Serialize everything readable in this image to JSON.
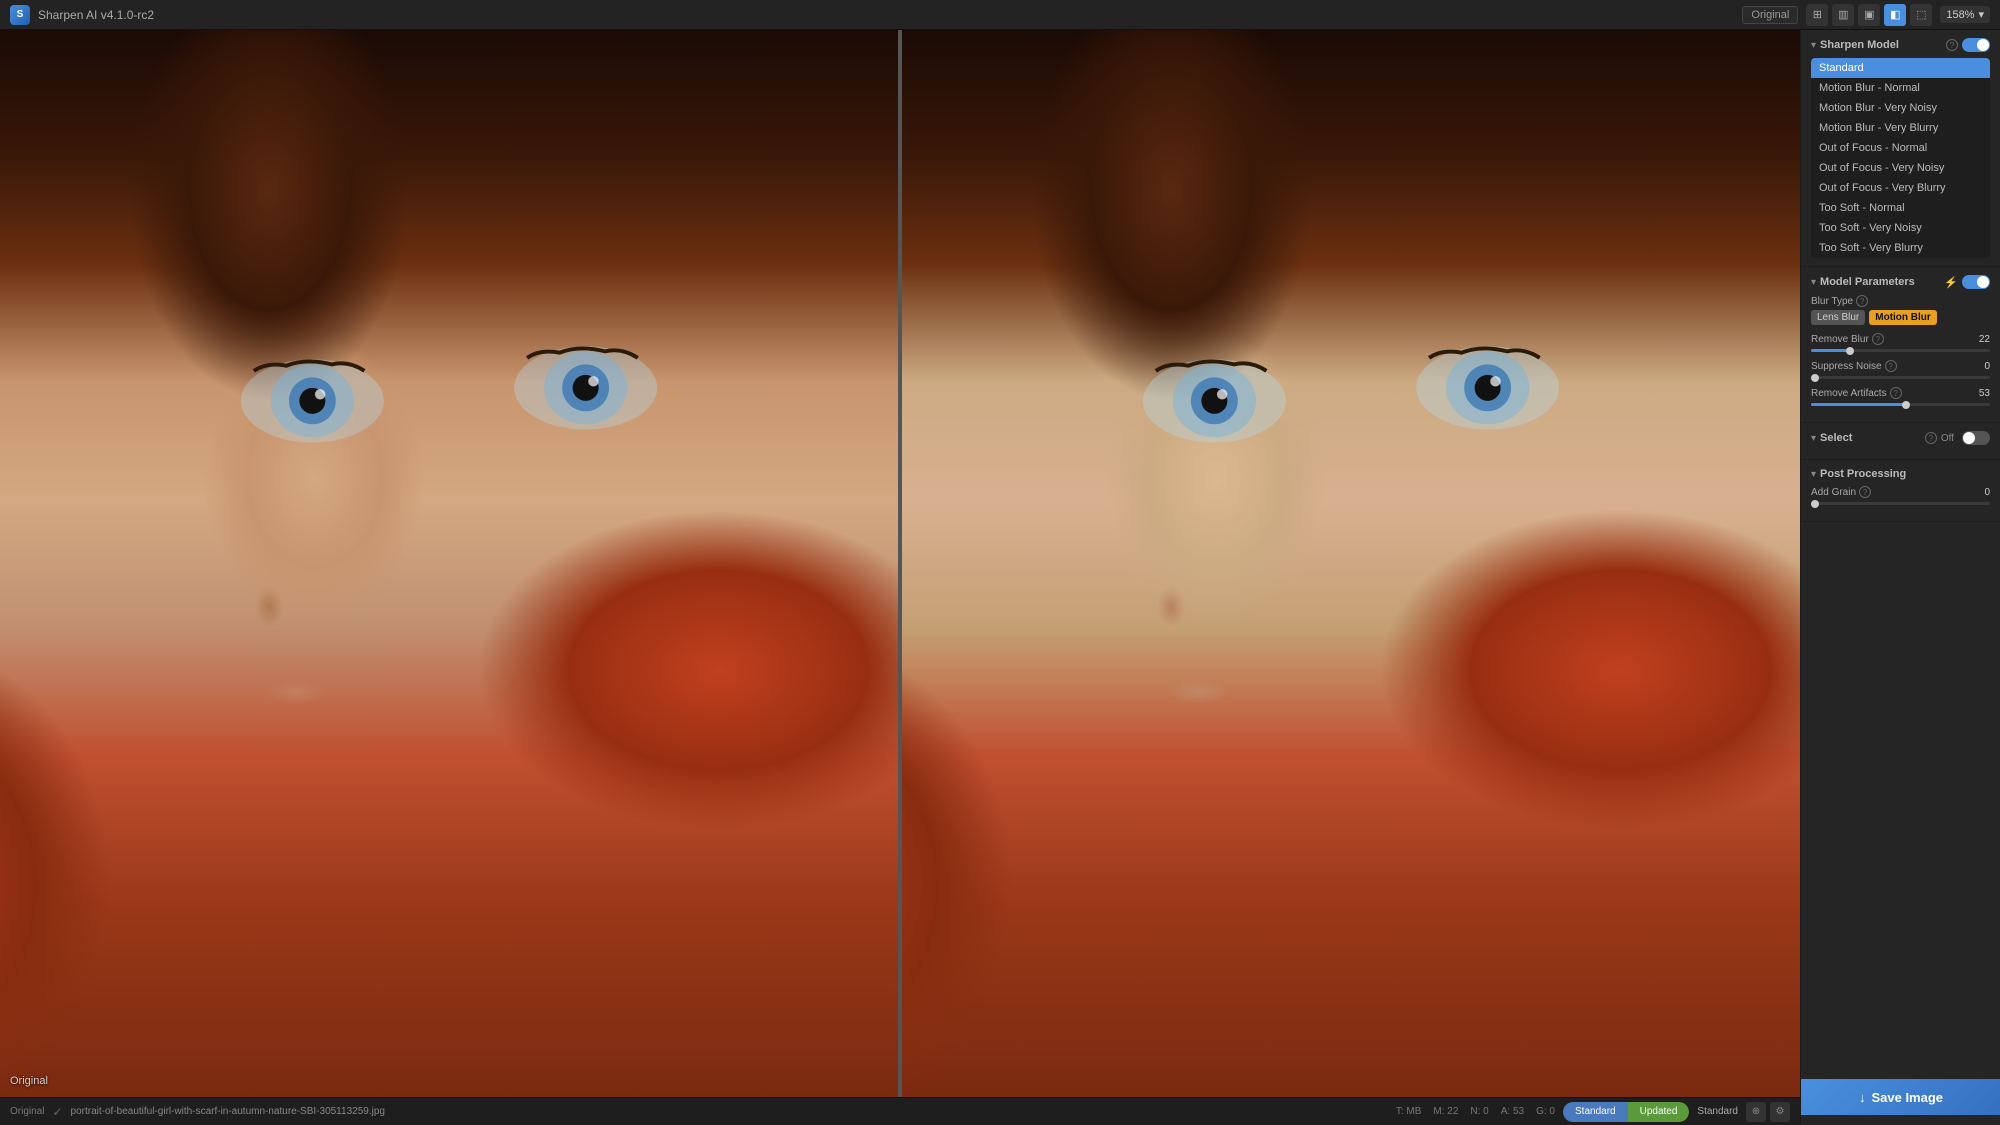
{
  "app": {
    "title": "Sharpen AI",
    "version": "v4.1.0-rc2",
    "logo": "S"
  },
  "topbar": {
    "original_btn": "Original",
    "zoom_level": "158%",
    "view_icons": [
      "grid-2x2",
      "grid-split",
      "side-by-side",
      "single-view",
      "compare"
    ]
  },
  "panels": {
    "sharpen_model": {
      "title": "Sharpen Model",
      "models": [
        {
          "id": "standard",
          "label": "Standard",
          "selected": true
        },
        {
          "id": "motion-blur-normal",
          "label": "Motion Blur - Normal",
          "selected": false
        },
        {
          "id": "motion-blur-very-noisy",
          "label": "Motion Blur - Very Noisy",
          "selected": false
        },
        {
          "id": "motion-blur-very-blurry",
          "label": "Motion Blur - Very Blurry",
          "selected": false
        },
        {
          "id": "out-of-focus-normal",
          "label": "Out of Focus - Normal",
          "selected": false
        },
        {
          "id": "out-of-focus-very-noisy",
          "label": "Out of Focus - Very Noisy",
          "selected": false
        },
        {
          "id": "out-of-focus-very-blurry",
          "label": "Out of Focus - Very Blurry",
          "selected": false
        },
        {
          "id": "too-soft-normal",
          "label": "Too Soft - Normal",
          "selected": false
        },
        {
          "id": "too-soft-very-noisy",
          "label": "Too Soft - Very Noisy",
          "selected": false
        },
        {
          "id": "too-soft-very-blurry",
          "label": "Too Soft - Very Blurry",
          "selected": false
        }
      ]
    },
    "model_parameters": {
      "title": "Model Parameters",
      "enabled": true,
      "blur_type": {
        "label": "Blur Type",
        "options": [
          "Lens Blur",
          "Motion Blur"
        ],
        "active": "Motion Blur"
      },
      "remove_blur": {
        "label": "Remove Blur",
        "value": 22,
        "min": 0,
        "max": 100,
        "fill_pct": 22
      },
      "suppress_noise": {
        "label": "Suppress Noise",
        "value": 0,
        "min": 0,
        "max": 100,
        "fill_pct": 0
      },
      "remove_artifacts": {
        "label": "Remove Artifacts",
        "value": 53,
        "min": 0,
        "max": 100,
        "fill_pct": 53
      }
    },
    "select": {
      "title": "Select",
      "state": "Off"
    },
    "post_processing": {
      "title": "Post Processing",
      "add_grain": {
        "label": "Add Grain",
        "value": 0,
        "min": 0,
        "max": 100,
        "fill_pct": 0
      }
    }
  },
  "bottom_bar": {
    "original_label": "Original",
    "file_path": "portrait-of-beautiful-girl-with-scarf-in-autumn-nature-SBI-305113259.jpg",
    "stats": {
      "t_mb": "T: MB",
      "m_value": "M: 22",
      "n_value": "N: 0",
      "a_value": "A: 53",
      "g_value": "G: 0"
    },
    "model_name": "Standard",
    "tabs": [
      {
        "id": "standard",
        "label": "Standard"
      },
      {
        "id": "updated",
        "label": "Updated"
      }
    ]
  },
  "save_button": {
    "label": "Save Image",
    "icon": "save-icon"
  },
  "image_labels": {
    "original": "Original"
  }
}
